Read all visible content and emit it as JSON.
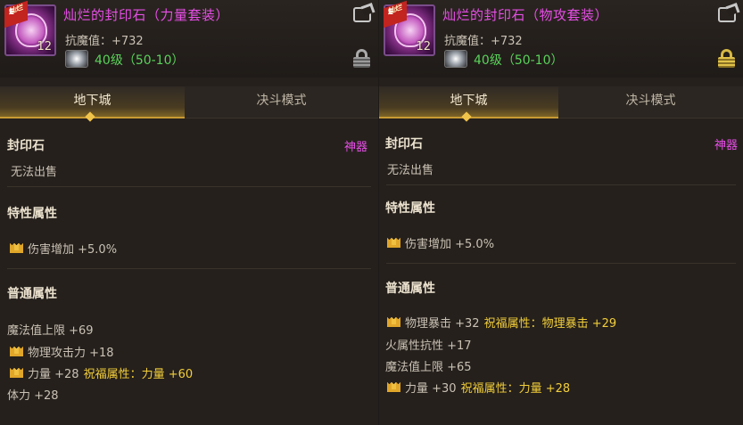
{
  "left": {
    "item_name": "灿烂的封印石（力量套装）",
    "icon": {
      "tag": "灿烂",
      "grade": "E",
      "count": "12"
    },
    "stat": "抗魔值：+732",
    "level": "40级（50-10）",
    "tabs": [
      "地下城",
      "决斗模式"
    ],
    "category": "封印石",
    "rarity": "神器",
    "trade": "无法出售",
    "special_title": "特性属性",
    "special": [
      {
        "text": "伤害增加 +5.0%",
        "crown": true
      }
    ],
    "normal_title": "普通属性",
    "normal": [
      {
        "text": "魔法值上限 +69",
        "crown": false,
        "bless": ""
      },
      {
        "text": "物理攻击力 +18",
        "crown": true,
        "bless": ""
      },
      {
        "text": "力量 +28",
        "crown": true,
        "bless": "祝福属性：力量 +60"
      },
      {
        "text": "体力 +28",
        "crown": false,
        "bless": ""
      }
    ]
  },
  "right": {
    "item_name": "灿烂的封印石（物攻套装）",
    "icon": {
      "tag": "灿烂",
      "grade": "E",
      "count": "12"
    },
    "stat": "抗魔值：+732",
    "level": "40级（50-10）",
    "tabs": [
      "地下城",
      "决斗模式"
    ],
    "category": "封印石",
    "rarity": "神器",
    "trade": "无法出售",
    "special_title": "特性属性",
    "special": [
      {
        "text": "伤害增加 +5.0%",
        "crown": true
      }
    ],
    "normal_title": "普通属性",
    "normal": [
      {
        "text": "物理暴击 +32",
        "crown": true,
        "bless": "祝福属性：物理暴击 +29"
      },
      {
        "text": "火属性抗性 +17",
        "crown": false,
        "bless": ""
      },
      {
        "text": "魔法值上限 +65",
        "crown": false,
        "bless": ""
      },
      {
        "text": "力量 +30",
        "crown": true,
        "bless": "祝福属性：力量 +28"
      }
    ]
  },
  "colors": {
    "item_name": "#e64fe6",
    "level": "#5ad25a",
    "bless": "#f3cf3a",
    "crown": "#e0a62a",
    "tab_active_border": "#c89a34"
  },
  "icons": {
    "share": "share-icon",
    "lock": "lock-icon",
    "crown": "crown-icon",
    "gem": "gem-icon",
    "seal_stone": "seal-stone-icon"
  }
}
